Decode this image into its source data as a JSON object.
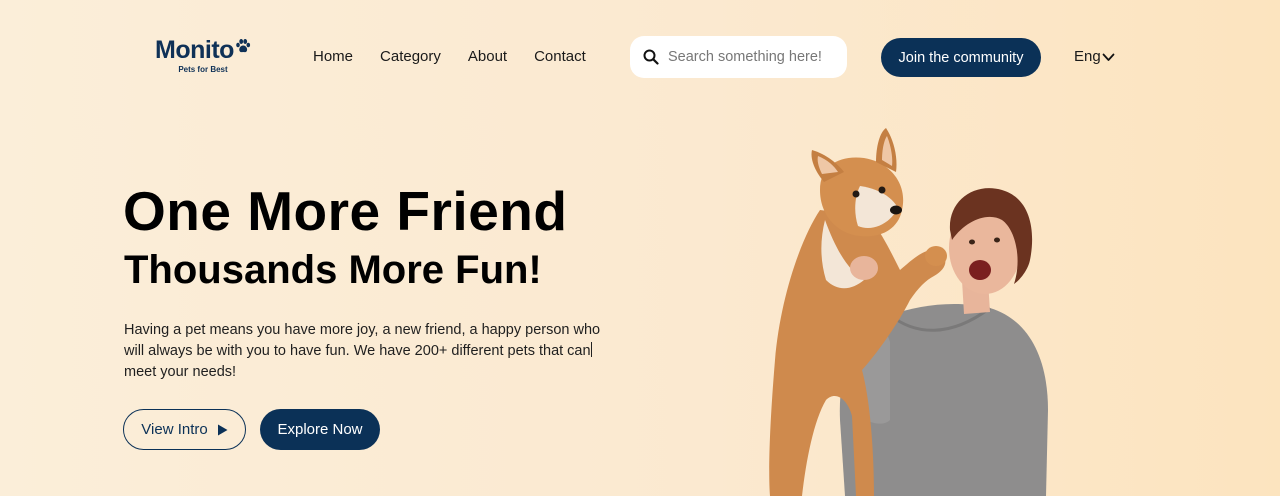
{
  "header": {
    "logo": {
      "name": "Monito",
      "tagline": "Pets for Best"
    },
    "nav": [
      {
        "label": "Home"
      },
      {
        "label": "Category"
      },
      {
        "label": "About"
      },
      {
        "label": "Contact"
      }
    ],
    "search": {
      "placeholder": "Search something here!",
      "value": ""
    },
    "join_button": "Join the community",
    "language": "Eng"
  },
  "hero": {
    "title": "One More Friend",
    "subtitle": "Thousands More Fun!",
    "description_part1": "Having a pet means you have more joy, a new friend, a happy person who will always be with you to have fun. We have 200+ different pets that can",
    "description_part2": "meet your needs!",
    "view_intro_button": "View Intro",
    "explore_button": "Explore Now"
  },
  "icons": [
    "paw-icon",
    "search-icon",
    "chevron-down-icon",
    "play-icon"
  ],
  "colors": {
    "primary": "#0b3157",
    "background": "#fbeed9",
    "search_bg": "#ffffff"
  }
}
